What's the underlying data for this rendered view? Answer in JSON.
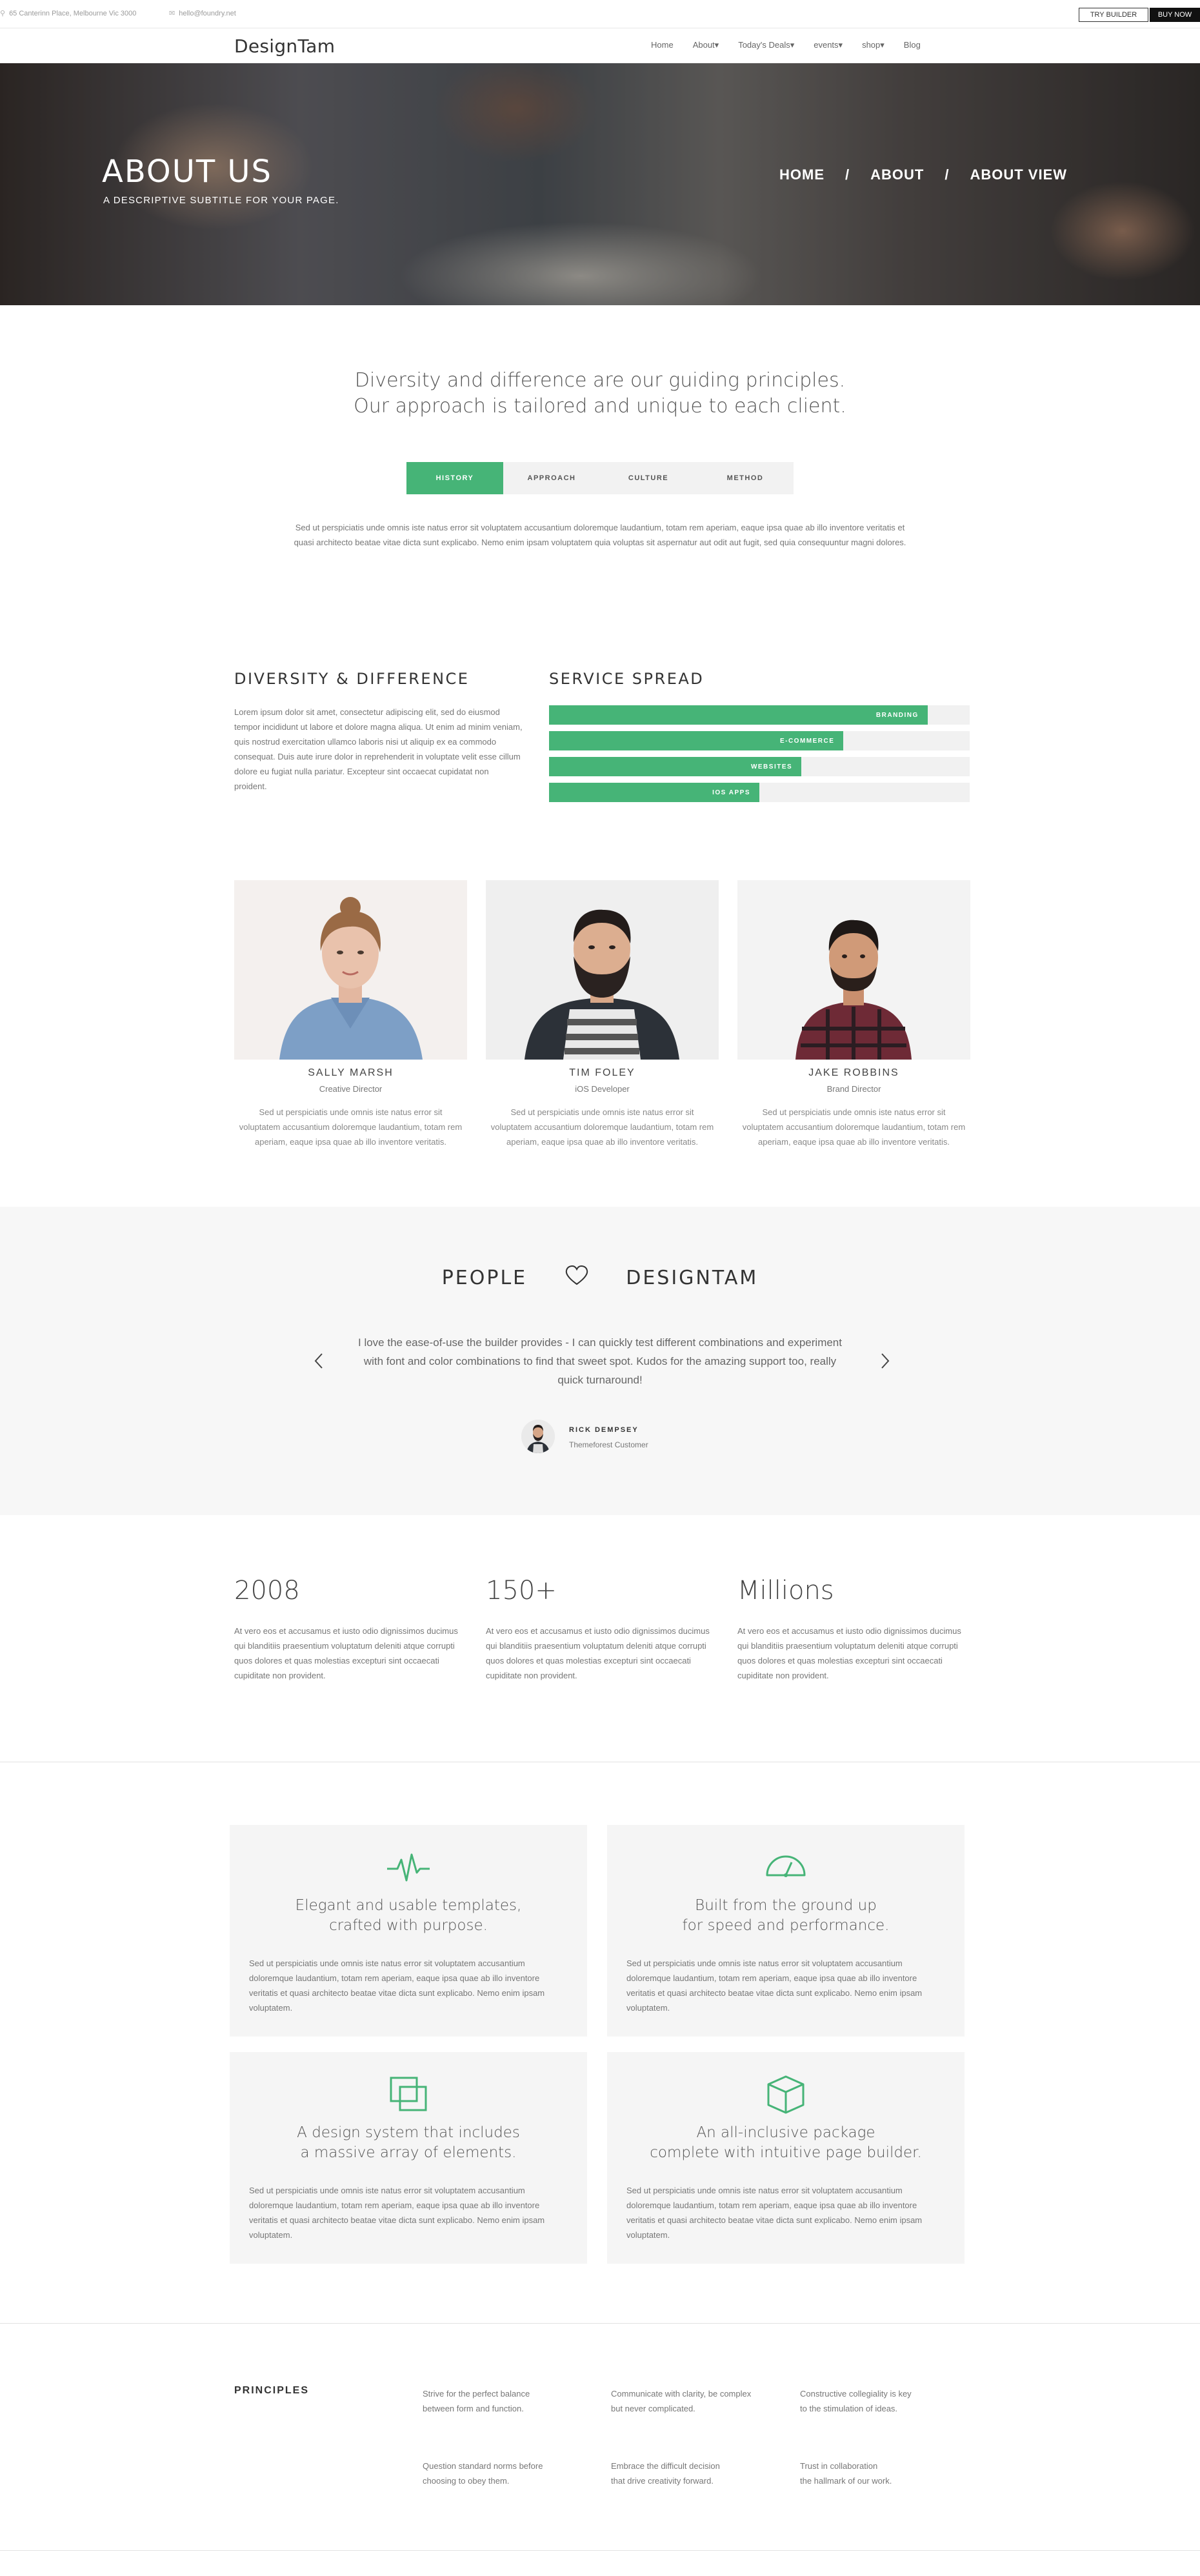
{
  "topbar": {
    "address": "65 Canterinn Place, Melbourne Vic 3000",
    "email": "hello@foundry.net",
    "try_builder": "TRY BUILDER",
    "buy_now": "BUY NOW"
  },
  "header": {
    "logo": "DesignTam",
    "nav": [
      "Home",
      "About▾",
      "Today's Deals▾",
      "events▾",
      "shop▾",
      "Blog"
    ]
  },
  "hero": {
    "title": "ABOUT US",
    "subtitle": "A DESCRIPTIVE SUBTITLE FOR YOUR PAGE.",
    "crumbs": [
      "HOME",
      "/",
      "ABOUT",
      "/",
      "ABOUT VIEW"
    ]
  },
  "intro": {
    "line1": "Diversity and difference are our guiding principles.",
    "line2": "Our approach is tailored and unique to each client."
  },
  "tabs": {
    "items": [
      "HISTORY",
      "APPROACH",
      "CULTURE",
      "METHOD"
    ],
    "active_index": 0,
    "content": "Sed ut perspiciatis unde omnis iste natus error sit voluptatem accusantium doloremque laudantium, totam rem aperiam, eaque ipsa quae ab illo inventore veritatis et quasi architecto beatae vitae dicta sunt explicabo. Nemo enim ipsam voluptatem quia voluptas sit aspernatur aut odit aut fugit, sed quia consequuntur magni dolores."
  },
  "diversity": {
    "heading": "DIVERSITY & DIFFERENCE",
    "text": "Lorem ipsum dolor sit amet, consectetur adipiscing elit, sed do eiusmod tempor incididunt ut labore et dolore magna aliqua. Ut enim ad minim veniam, quis nostrud exercitation ullamco laboris nisi ut aliquip ex ea commodo consequat. Duis aute irure dolor in reprehenderit in voluptate velit esse cillum dolore eu fugiat nulla pariatur. Excepteur sint occaecat cupidatat non proident."
  },
  "service": {
    "heading": "SERVICE SPREAD",
    "bars": [
      {
        "label": "BRANDING",
        "level": 0.9
      },
      {
        "label": "E-COMMERCE",
        "level": 0.7
      },
      {
        "label": "WEBSITES",
        "level": 0.6
      },
      {
        "label": "IOS APPS",
        "level": 0.5
      }
    ]
  },
  "team": [
    {
      "name": "SALLY MARSH",
      "role": "Creative Director",
      "bio": "Sed ut perspiciatis unde omnis iste natus error sit voluptatem accusantium doloremque laudantium, totam rem aperiam, eaque ipsa quae ab illo inventore veritatis."
    },
    {
      "name": "TIM FOLEY",
      "role": "iOS Developer",
      "bio": "Sed ut perspiciatis unde omnis iste natus error sit voluptatem accusantium doloremque laudantium, totam rem aperiam, eaque ipsa quae ab illo inventore veritatis."
    },
    {
      "name": "JAKE ROBBINS",
      "role": "Brand Director",
      "bio": "Sed ut perspiciatis unde omnis iste natus error sit voluptatem accusantium doloremque laudantium, totam rem aperiam, eaque ipsa quae ab illo inventore veritatis."
    }
  ],
  "testimonial": {
    "heading_left": "PEOPLE",
    "heading_right": "DESIGNTAM",
    "quote": "I love the ease-of-use the builder provides - I can quickly test different combinations and experiment with font and color combinations to find that sweet spot. Kudos for the amazing support too, really quick turnaround!",
    "name": "RICK DEMPSEY",
    "role": "Themeforest Customer"
  },
  "stats": [
    {
      "value": "2008",
      "text": "At vero eos et accusamus et iusto odio dignissimos ducimus qui blanditiis praesentium voluptatum deleniti atque corrupti quos dolores et quas molestias excepturi sint occaecati cupiditate non provident."
    },
    {
      "value": "150+",
      "text": "At vero eos et accusamus et iusto odio dignissimos ducimus qui blanditiis praesentium voluptatum deleniti atque corrupti quos dolores et quas molestias excepturi sint occaecati cupiditate non provident."
    },
    {
      "value": "Millions",
      "text": "At vero eos et accusamus et iusto odio dignissimos ducimus qui blanditiis praesentium voluptatum deleniti atque corrupti quos dolores et quas molestias excepturi sint occaecati cupiditate non provident."
    }
  ],
  "features": [
    {
      "icon": "pulse-icon",
      "title1": "Elegant and usable templates,",
      "title2": "crafted with purpose.",
      "text": "Sed ut perspiciatis unde omnis iste natus error sit voluptatem accusantium doloremque laudantium, totam rem aperiam, eaque ipsa quae ab illo inventore veritatis et quasi architecto beatae vitae dicta sunt explicabo. Nemo enim ipsam voluptatem."
    },
    {
      "icon": "speedometer-icon",
      "title1": "Built from the ground up",
      "title2": "for speed and performance.",
      "text": "Sed ut perspiciatis unde omnis iste natus error sit voluptatem accusantium doloremque laudantium, totam rem aperiam, eaque ipsa quae ab illo inventore veritatis et quasi architecto beatae vitae dicta sunt explicabo. Nemo enim ipsam voluptatem."
    },
    {
      "icon": "layers-icon",
      "title1": "A design system that includes",
      "title2": "a massive array of elements.",
      "text": "Sed ut perspiciatis unde omnis iste natus error sit voluptatem accusantium doloremque laudantium, totam rem aperiam, eaque ipsa quae ab illo inventore veritatis et quasi architecto beatae vitae dicta sunt explicabo. Nemo enim ipsam voluptatem."
    },
    {
      "icon": "box-icon",
      "title1": "An all-inclusive package",
      "title2": "complete with intuitive page builder.",
      "text": "Sed ut perspiciatis unde omnis iste natus error sit voluptatem accusantium doloremque laudantium, totam rem aperiam, eaque ipsa quae ab illo inventore veritatis et quasi architecto beatae vitae dicta sunt explicabo. Nemo enim ipsam voluptatem."
    }
  ],
  "principles": {
    "heading": "PRINCIPLES",
    "items": [
      {
        "l1": "Strive for the perfect balance",
        "l2": "between form and function."
      },
      {
        "l1": "Communicate with clarity, be complex",
        "l2": "but never complicated."
      },
      {
        "l1": "Constructive collegiality is key",
        "l2": "to the stimulation of ideas."
      },
      {
        "l1": "Question standard norms before",
        "l2": "choosing to obey them."
      },
      {
        "l1": "Embrace the difficult decision",
        "l2": "that drive creativity forward."
      },
      {
        "l1": "Trust in collaboration",
        "l2": "the hallmark of our work."
      }
    ]
  },
  "colors": {
    "accent": "#46b477",
    "light_bg": "#f7f7f7",
    "text": "#555555"
  }
}
